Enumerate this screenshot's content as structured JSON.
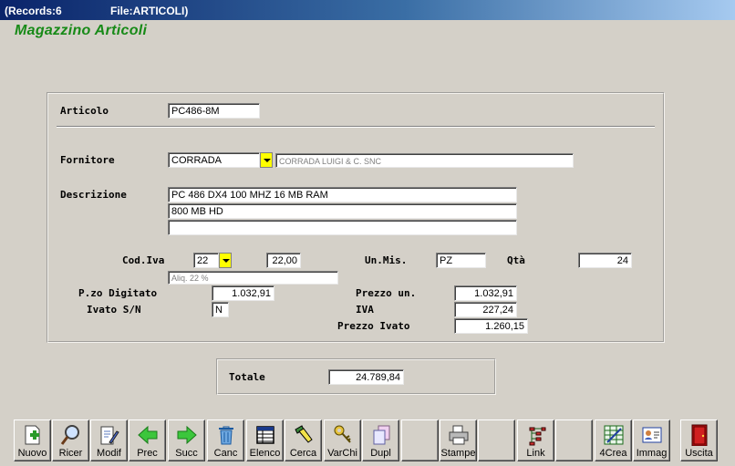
{
  "titlebar": {
    "records": "(Records:6",
    "file": "File:ARTICOLI)"
  },
  "app_title": "Magazzino Articoli",
  "form": {
    "articolo": {
      "label": "Articolo",
      "value": "PC486-8M"
    },
    "fornitore": {
      "label": "Fornitore",
      "value": "CORRADA",
      "description": "CORRADA LUIGI & C. SNC"
    },
    "descrizione": {
      "label": "Descrizione",
      "line1": "PC 486 DX4 100 MHZ 16 MB RAM",
      "line2": "800 MB HD",
      "line3": ""
    },
    "cod_iva": {
      "label": "Cod.Iva",
      "value": "22",
      "aliquota": "22,00",
      "description": "Aliq. 22 %"
    },
    "un_mis": {
      "label": "Un.Mis.",
      "value": "PZ"
    },
    "qta": {
      "label": "Qtà",
      "value": "24"
    },
    "pzo_digitato": {
      "label": "P.zo Digitato",
      "value": "1.032,91"
    },
    "ivato": {
      "label": "Ivato S/N",
      "value": "N"
    },
    "prezzo_un": {
      "label": "Prezzo un.",
      "value": "1.032,91"
    },
    "iva": {
      "label": "IVA",
      "value": "227,24"
    },
    "prezzo_ivato": {
      "label": "Prezzo Ivato",
      "value": "1.260,15"
    }
  },
  "totale": {
    "label": "Totale",
    "value": "24.789,84"
  },
  "toolbar": {
    "nuovo": "Nuovo",
    "ricer": "Ricer",
    "modif": "Modif",
    "prec": "Prec",
    "succ": "Succ",
    "canc": "Canc",
    "elenco": "Elenco",
    "cerca": "Cerca",
    "varchi": "VarChi",
    "dupl": "Dupl",
    "stampe": "Stampe",
    "link": "Link",
    "crea4": "4Crea",
    "immag": "Immag",
    "uscita": "Uscita"
  },
  "colors": {
    "title_green": "#178a17",
    "dropdown_yellow": "#ffff00",
    "titlebar_blue": "#0a246a"
  }
}
